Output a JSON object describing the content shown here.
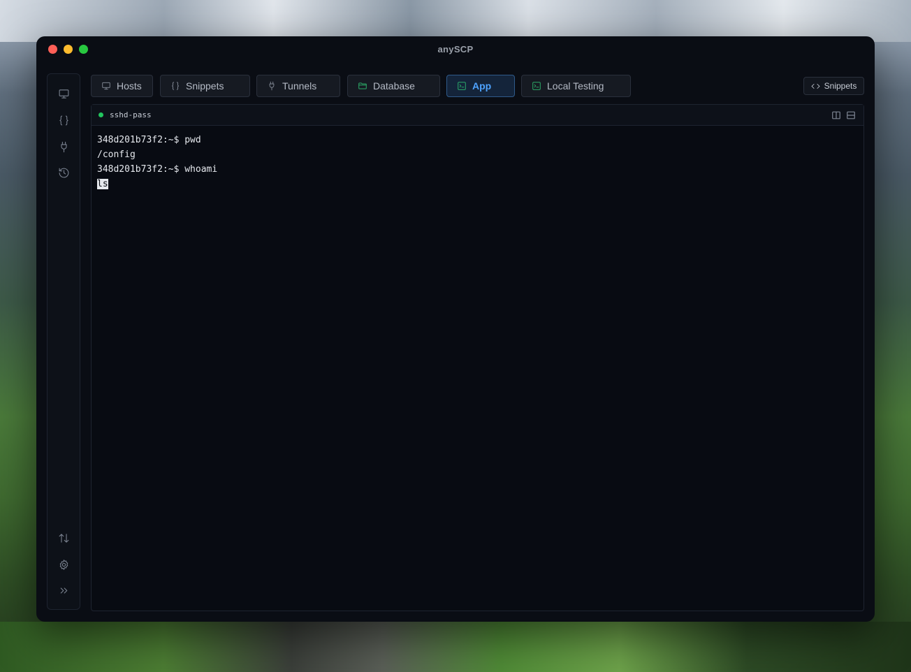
{
  "window": {
    "title": "anySCP"
  },
  "tabs": [
    {
      "label": "Hosts",
      "icon": "monitor-icon",
      "state": "inactive"
    },
    {
      "label": "Snippets",
      "icon": "braces-icon",
      "state": "inactive"
    },
    {
      "label": "Tunnels",
      "icon": "plug-icon",
      "state": "inactive"
    },
    {
      "label": "Database",
      "icon": "folder-icon",
      "state": "inactive"
    },
    {
      "label": "App",
      "icon": "terminal-icon",
      "state": "active"
    },
    {
      "label": "Local Testing",
      "icon": "terminal-icon",
      "state": "inactive"
    }
  ],
  "toolbar": {
    "snippets_label": "Snippets"
  },
  "sidebar": {
    "top_icons": [
      "monitor-icon",
      "braces-icon",
      "plug-icon",
      "history-icon"
    ],
    "bottom_icons": [
      "transfer-icon",
      "gear-icon",
      "expand-icon"
    ]
  },
  "session": {
    "name": "sshd-pass",
    "status_color": "#22c55e"
  },
  "terminal": {
    "lines": [
      "348d201b73f2:~$ pwd",
      "/config",
      "348d201b73f2:~$ whoami"
    ],
    "current_input": "ls"
  },
  "colors": {
    "accent": "#4ea3ff",
    "tab_icon_green": "#2fbf71"
  }
}
